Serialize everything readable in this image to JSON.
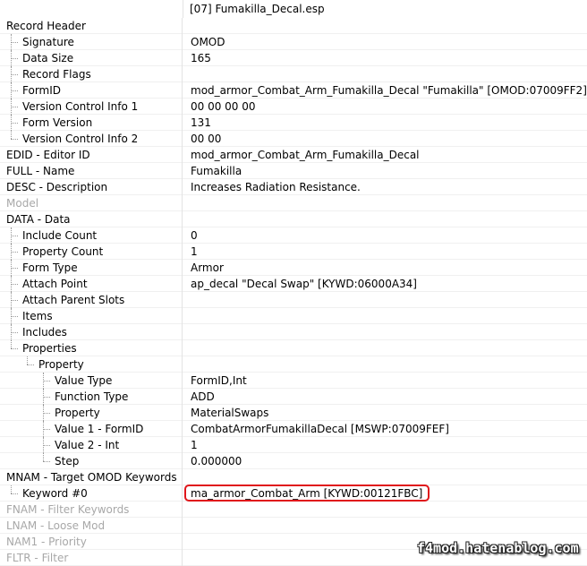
{
  "header": {
    "file": "[07] Fumakilla_Decal.esp"
  },
  "rows": [
    {
      "label": "Record Header",
      "value": ""
    },
    {
      "label": "Signature",
      "value": "OMOD"
    },
    {
      "label": "Data Size",
      "value": "165"
    },
    {
      "label": "Record Flags",
      "value": ""
    },
    {
      "label": "FormID",
      "value": "mod_armor_Combat_Arm_Fumakilla_Decal \"Fumakilla\" [OMOD:07009FF2]"
    },
    {
      "label": "Version Control Info 1",
      "value": "00 00 00 00"
    },
    {
      "label": "Form Version",
      "value": "131"
    },
    {
      "label": "Version Control Info 2",
      "value": "00 00"
    },
    {
      "label": "EDID - Editor ID",
      "value": "mod_armor_Combat_Arm_Fumakilla_Decal"
    },
    {
      "label": "FULL - Name",
      "value": "Fumakilla"
    },
    {
      "label": "DESC - Description",
      "value": "Increases Radiation Resistance."
    },
    {
      "label": "Model",
      "value": ""
    },
    {
      "label": "DATA - Data",
      "value": ""
    },
    {
      "label": "Include Count",
      "value": "0"
    },
    {
      "label": "Property Count",
      "value": "1"
    },
    {
      "label": "Form Type",
      "value": "Armor"
    },
    {
      "label": "Attach Point",
      "value": "ap_decal \"Decal Swap\" [KYWD:06000A34]"
    },
    {
      "label": "Attach Parent Slots",
      "value": ""
    },
    {
      "label": "Items",
      "value": ""
    },
    {
      "label": "Includes",
      "value": ""
    },
    {
      "label": "Properties",
      "value": ""
    },
    {
      "label": "Property",
      "value": ""
    },
    {
      "label": "Value Type",
      "value": "FormID,Int"
    },
    {
      "label": "Function Type",
      "value": "ADD"
    },
    {
      "label": "Property",
      "value": "MaterialSwaps"
    },
    {
      "label": "Value 1 - FormID",
      "value": "CombatArmorFumakillaDecal [MSWP:07009FEF]"
    },
    {
      "label": "Value 2 - Int",
      "value": "1"
    },
    {
      "label": "Step",
      "value": "0.000000"
    },
    {
      "label": "MNAM - Target OMOD Keywords",
      "value": ""
    },
    {
      "label": "Keyword #0",
      "value": "ma_armor_Combat_Arm [KYWD:00121FBC]"
    },
    {
      "label": "FNAM - Filter Keywords",
      "value": ""
    },
    {
      "label": "LNAM - Loose Mod",
      "value": ""
    },
    {
      "label": "NAM1 - Priority",
      "value": ""
    },
    {
      "label": "FLTR - Filter",
      "value": ""
    }
  ],
  "watermark": "f4mod.hatenablog.com",
  "colors": {
    "highlight": "#e0161b",
    "dim_text": "#a8a8a8"
  }
}
